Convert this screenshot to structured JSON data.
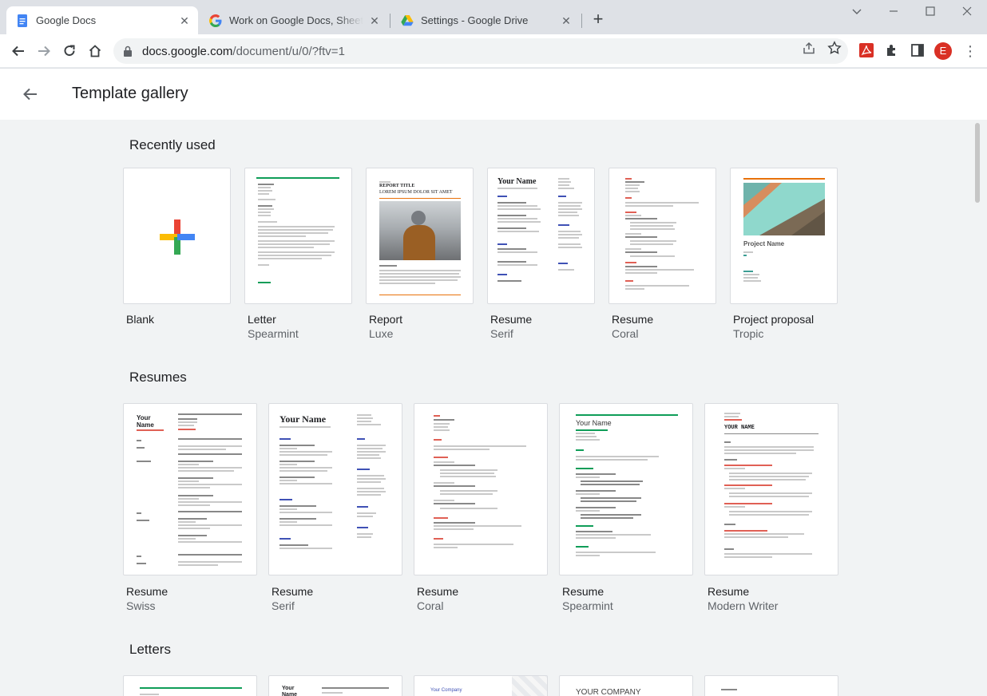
{
  "browser": {
    "tabs": [
      {
        "title": "Google Docs",
        "active": true
      },
      {
        "title": "Work on Google Docs, Sheets, & Slides",
        "active": false
      },
      {
        "title": "Settings - Google Drive",
        "active": false
      }
    ],
    "url_main": "docs.google.com",
    "url_rest": "/document/u/0/?ftv=1",
    "profile_initial": "E"
  },
  "header": {
    "title": "Template gallery"
  },
  "sections": [
    {
      "title": "Recently used",
      "templates": [
        {
          "name": "Blank",
          "style": ""
        },
        {
          "name": "Letter",
          "style": "Spearmint"
        },
        {
          "name": "Report",
          "style": "Luxe"
        },
        {
          "name": "Resume",
          "style": "Serif"
        },
        {
          "name": "Resume",
          "style": "Coral"
        },
        {
          "name": "Project proposal",
          "style": "Tropic"
        }
      ]
    },
    {
      "title": "Resumes",
      "templates": [
        {
          "name": "Resume",
          "style": "Swiss"
        },
        {
          "name": "Resume",
          "style": "Serif"
        },
        {
          "name": "Resume",
          "style": "Coral"
        },
        {
          "name": "Resume",
          "style": "Spearmint"
        },
        {
          "name": "Resume",
          "style": "Modern Writer"
        }
      ]
    },
    {
      "title": "Letters",
      "templates": []
    }
  ],
  "thumbs": {
    "report_title": "REPORT TITLE",
    "report_subtitle": "LOREM IPSUM DOLOR SIT AMET",
    "your_name": "Your Name",
    "project_name": "Project Name",
    "your_company": "YOUR COMPANY",
    "your_company_blue": "Your Company",
    "your_name_caps": "YOUR NAME"
  },
  "colors": {
    "accent_blue": "#4285f4",
    "accent_red": "#ea4335",
    "accent_yellow": "#fbbc04",
    "accent_green": "#34a853"
  }
}
